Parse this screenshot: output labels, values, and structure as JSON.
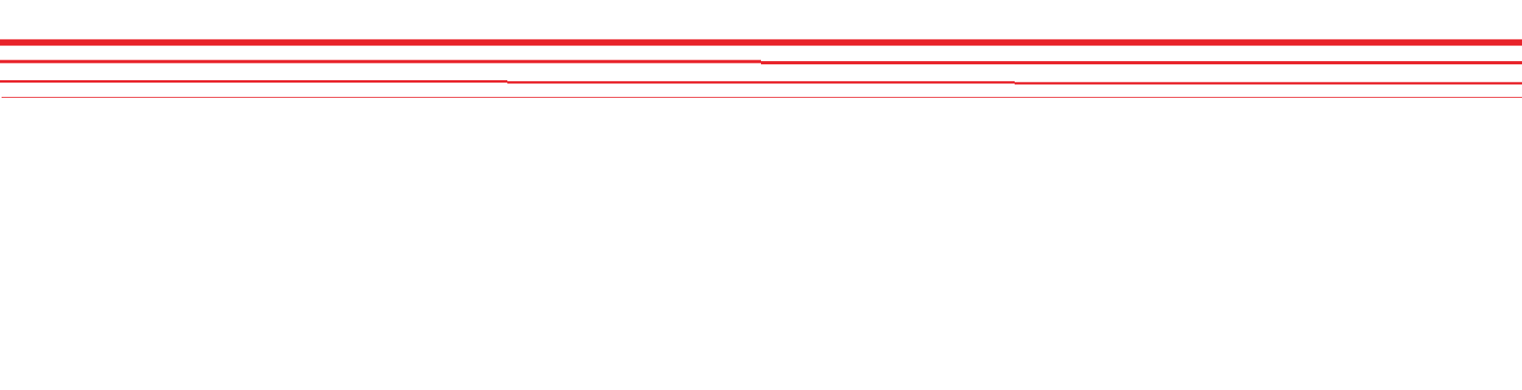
{
  "colors": {
    "background": "#ffffff",
    "line": "#e8232a"
  },
  "rule_groups": [
    {
      "id": "full",
      "segment_count": 1
    },
    {
      "id": "halves",
      "segment_count": 2
    },
    {
      "id": "thirds",
      "segment_count": 3
    },
    {
      "id": "hairline",
      "segment_count": 1
    }
  ]
}
